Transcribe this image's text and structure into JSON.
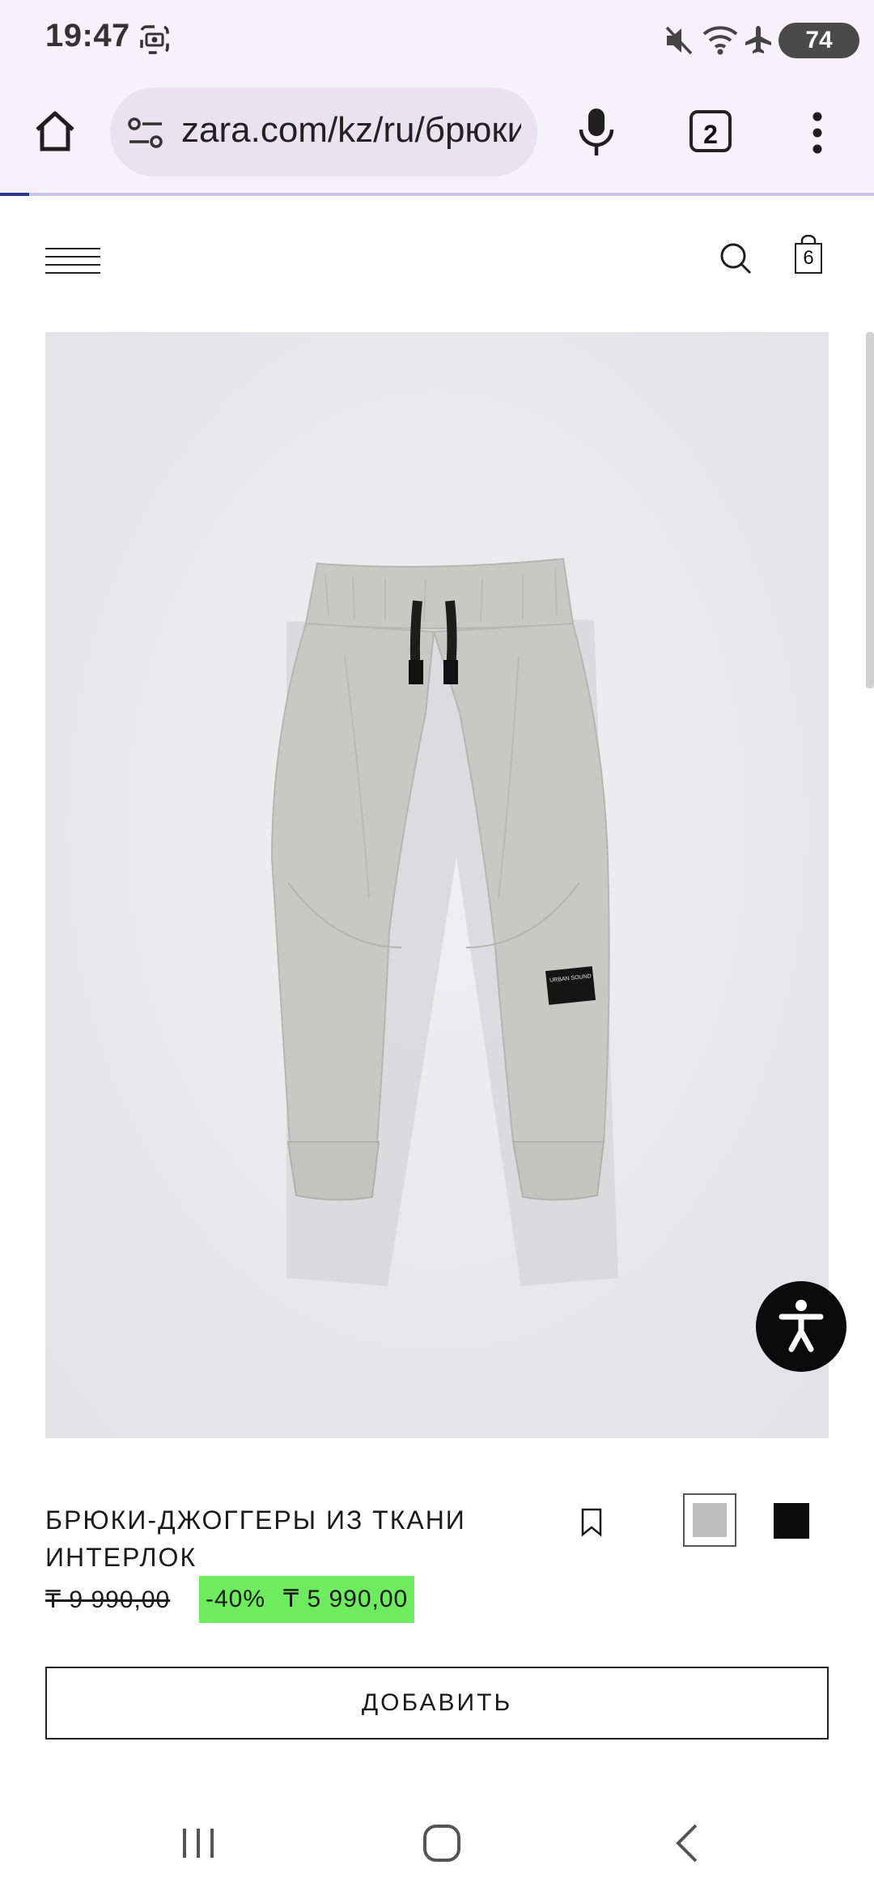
{
  "status_bar": {
    "time": "19:47",
    "battery": "74",
    "icons": [
      "screenshot-icon",
      "mute-icon",
      "wifi-icon",
      "airplane-icon"
    ]
  },
  "browser": {
    "url": "zara.com/kz/ru/брюки",
    "tab_count": "2",
    "page_load_progress": 0.033,
    "icons": [
      "home-icon",
      "site-settings-icon",
      "mic-icon",
      "more-icon"
    ]
  },
  "site_header": {
    "bag_count": "6",
    "icons": [
      "menu-icon",
      "search-icon",
      "bag-icon"
    ]
  },
  "product": {
    "title": "БРЮКИ-ДЖОГГЕРЫ ИЗ ТКАНИ ИНТЕРЛОК",
    "price_old": "₸ 9 990,00",
    "discount": "-40%",
    "price_new": "₸ 5 990,00",
    "colors": [
      "#bdbdbd",
      "#0b0b0b"
    ],
    "selected_color_index": 0,
    "add_button": "ДОБАВИТЬ",
    "image_label_text": "URBAN SOUND"
  },
  "colors": {
    "discount_bg": "#6eeb5f",
    "browser_bg": "#f6f2fc",
    "product_bg": "#e9e9ec"
  }
}
